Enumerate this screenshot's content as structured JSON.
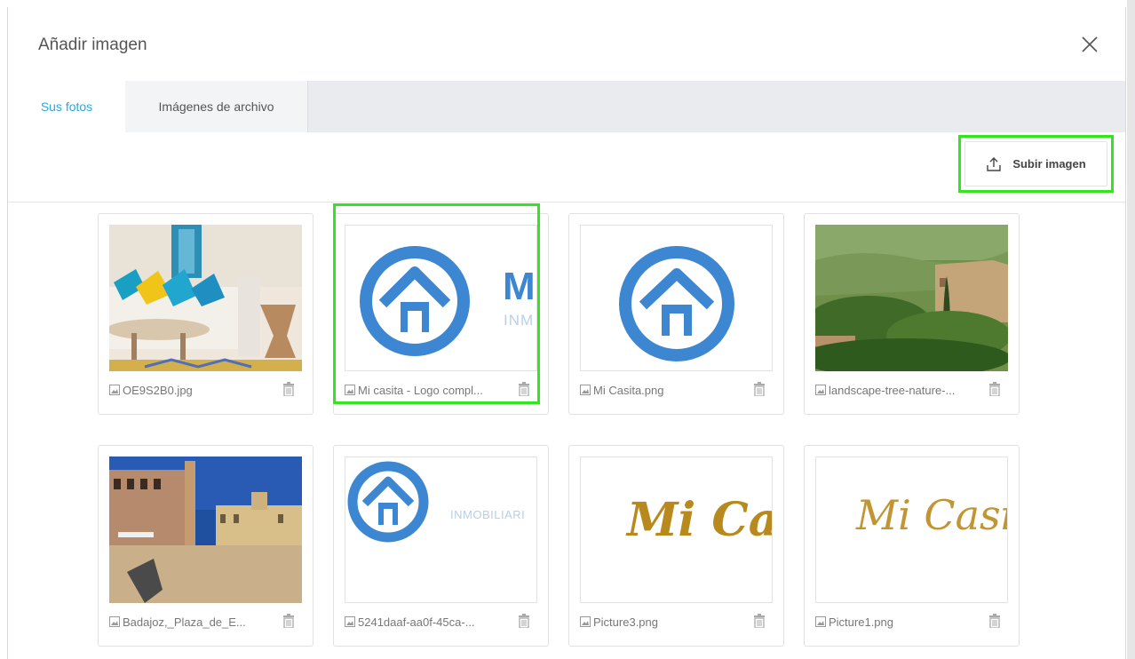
{
  "modal": {
    "title": "Añadir imagen"
  },
  "tabs": [
    {
      "label": "Sus fotos",
      "active": true
    },
    {
      "label": "Imágenes de archivo",
      "active": false
    }
  ],
  "toolbar": {
    "upload_label": "Subir imagen"
  },
  "photos": [
    {
      "name": "OE9S2B0.jpg"
    },
    {
      "name": "Mi casita - Logo compl...",
      "highlighted": true
    },
    {
      "name": "Mi Casita.png"
    },
    {
      "name": "landscape-tree-nature-..."
    },
    {
      "name": "Badajoz,_Plaza_de_E..."
    },
    {
      "name": "5241daaf-aa0f-45ca-..."
    },
    {
      "name": "Picture3.png"
    },
    {
      "name": "Picture1.png"
    }
  ],
  "logo_text": {
    "initial": "M",
    "brand": "INM",
    "brand_full": "INMOBILIARI",
    "script_bold": "Mi Ca",
    "script_light": "Mi Casit"
  },
  "colors": {
    "accent": "#2aa8e0",
    "highlight": "#33e51e",
    "logo_blue": "#3d86d1",
    "script_gold": "#b88a1e"
  }
}
